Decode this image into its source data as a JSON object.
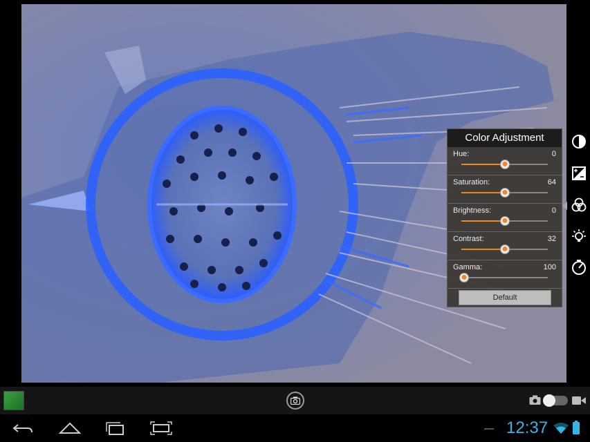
{
  "panel": {
    "title": "Color Adjustment",
    "sliders": [
      {
        "label": "Hue:",
        "value": "0",
        "level": 0.5
      },
      {
        "label": "Saturation:",
        "value": "64",
        "level": 0.5
      },
      {
        "label": "Brightness:",
        "value": "0",
        "level": 0.5
      },
      {
        "label": "Contrast:",
        "value": "32",
        "level": 0.5
      },
      {
        "label": "Gamma:",
        "value": "100",
        "level": 0.0
      }
    ],
    "default_label": "Default"
  },
  "status": {
    "clock": "12:37"
  },
  "icons": {
    "tools": [
      "contrast-icon",
      "exposure-icon",
      "color-channels-icon",
      "brightness-icon",
      "timer-icon"
    ],
    "nav": [
      "back-icon",
      "home-icon",
      "recent-apps-icon",
      "screenshot-icon"
    ]
  },
  "colors": {
    "accent": "#e8892a",
    "clock": "#33b5e5"
  }
}
